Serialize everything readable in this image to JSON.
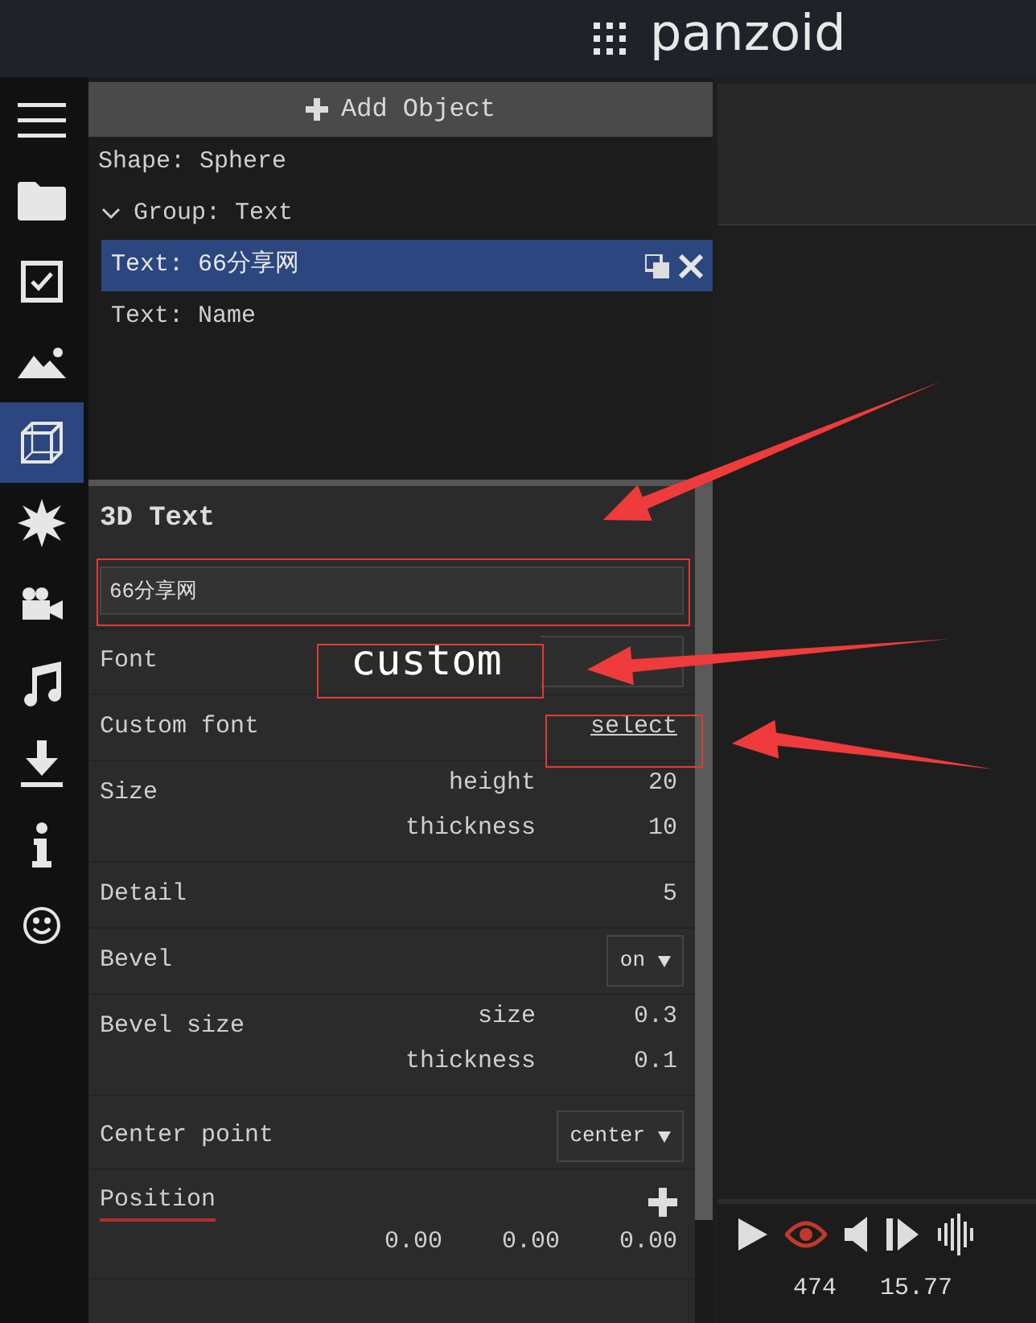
{
  "header": {
    "logo": "panzoid"
  },
  "sidebar": {
    "items": [
      {
        "kind": "menu",
        "selected": false
      },
      {
        "kind": "folder",
        "selected": false
      },
      {
        "kind": "checkbox",
        "selected": false
      },
      {
        "kind": "image",
        "selected": false
      },
      {
        "kind": "cube",
        "selected": true
      },
      {
        "kind": "burst",
        "selected": false
      },
      {
        "kind": "camera",
        "selected": false
      },
      {
        "kind": "music",
        "selected": false
      },
      {
        "kind": "download",
        "selected": false
      },
      {
        "kind": "info",
        "selected": false
      },
      {
        "kind": "smiley",
        "selected": false
      }
    ]
  },
  "object_list": {
    "add_button": "Add Object",
    "items": [
      {
        "label": "Shape: Sphere",
        "selected": false
      },
      {
        "label": "Group: Text",
        "selected": false,
        "expanded": true,
        "children": [
          {
            "label": "Text: 66分享网",
            "selected": true
          },
          {
            "label": "Text: Name",
            "selected": false
          }
        ]
      }
    ]
  },
  "properties": {
    "title": "3D Text",
    "text_value": "66分享网",
    "rows": [
      {
        "kind": "select",
        "label": "Font",
        "value": "custom",
        "large": true
      },
      {
        "kind": "link",
        "label": "Custom font",
        "value": "select"
      },
      {
        "kind": "pairs",
        "label": "Size",
        "pairs": [
          {
            "name": "height",
            "value": "20"
          },
          {
            "name": "thickness",
            "value": "10"
          }
        ]
      },
      {
        "kind": "number",
        "label": "Detail",
        "value": "5"
      },
      {
        "kind": "select",
        "label": "Bevel",
        "value": "on",
        "large": false
      },
      {
        "kind": "pairs",
        "label": "Bevel size",
        "pairs": [
          {
            "name": "size",
            "value": "0.3"
          },
          {
            "name": "thickness",
            "value": "0.1"
          }
        ]
      },
      {
        "kind": "select",
        "label": "Center point",
        "value": "center",
        "large": false
      },
      {
        "kind": "vector",
        "label": "Position",
        "values": [
          "0.00",
          "0.00",
          "0.00"
        ]
      }
    ]
  },
  "player": {
    "readings": [
      "474",
      "15.77"
    ]
  }
}
